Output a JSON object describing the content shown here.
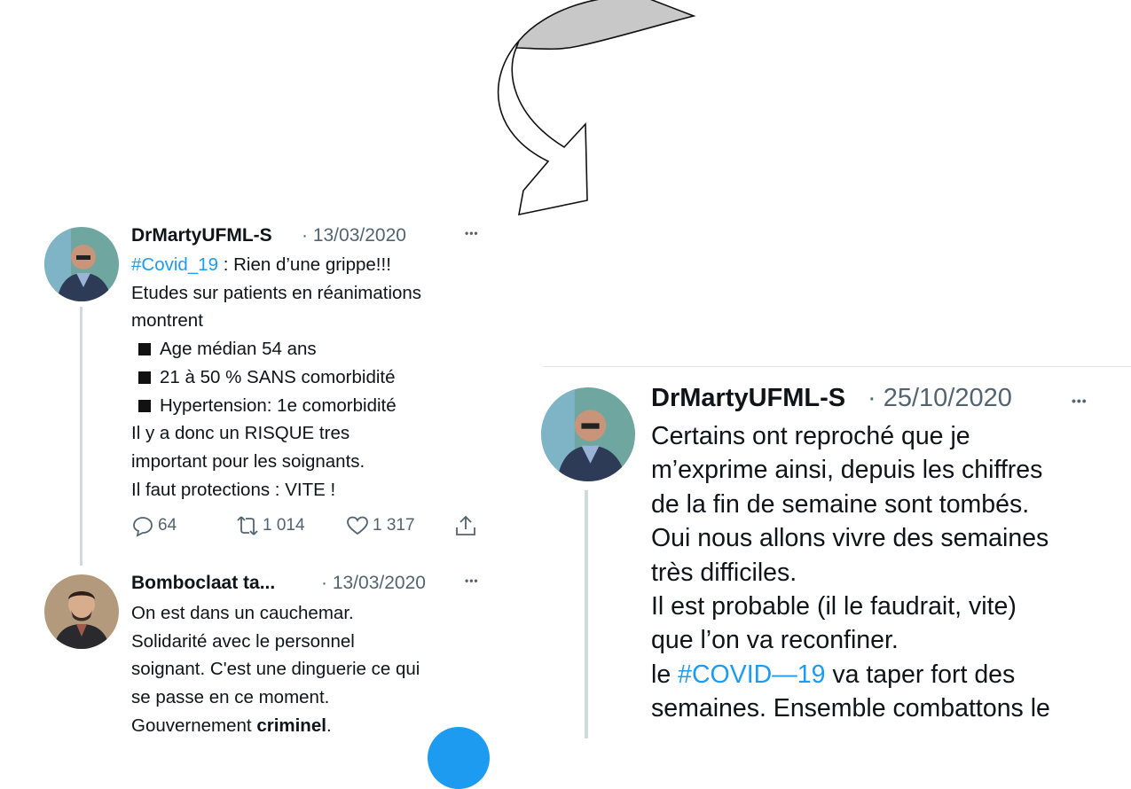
{
  "tweet_1": {
    "author": "DrMartyUFML-S",
    "date": "· 13/03/2020",
    "more_icon": "•••",
    "hashtag": "#Covid_19",
    "line_1_rest": " : Rien d’une grippe!!!",
    "line_2": "Etudes sur patients en réanimations",
    "line_3": "montrent",
    "bullets": [
      "Age médian 54 ans",
      "21 à 50 % SANS comorbidité",
      "Hypertension: 1e comorbidité"
    ],
    "line_7": "Il y a donc un RISQUE tres",
    "line_8": "important pour les soignants.",
    "line_9": "Il faut protections : VITE !",
    "replies": "64",
    "retweets": "1 014",
    "likes": "1 317"
  },
  "tweet_2": {
    "author": "Bomboclaat ta...",
    "date": "· 13/03/2020",
    "more_icon": "•••",
    "line_1": "On est dans un cauchemar.",
    "line_2": "Solidarité avec le personnel",
    "line_3": "soignant. C'est une dinguerie ce qui",
    "line_4": "se passe en ce moment.",
    "line_5_prefix": "Gouvernement ",
    "line_5_bold": "criminel",
    "line_5_suffix": "."
  },
  "tweet_3": {
    "author": "DrMartyUFML-S",
    "date": "· 25/10/2020",
    "more_icon": "•••",
    "lines": [
      "Certains ont reproché que je",
      "m’exprime ainsi, depuis les chiffres",
      "de la fin de semaine sont tombés.",
      "Oui nous allons vivre des semaines",
      "très difficiles.",
      "Il est probable (il le faudrait, vite)",
      "que l’on va reconfiner."
    ],
    "line_8_prefix": "le ",
    "line_8_hashtag": "#COVID—19",
    "line_8_suffix": " va taper fort des",
    "line_9": "semaines. Ensemble combattons le"
  },
  "colors": {
    "link": "#1d9bf0",
    "muted": "#536471",
    "text": "#0f1419",
    "arrow_fill": "#c8c8c8"
  },
  "icons": [
    "reply-icon",
    "retweet-icon",
    "like-icon",
    "share-icon",
    "curved-arrow-icon"
  ]
}
